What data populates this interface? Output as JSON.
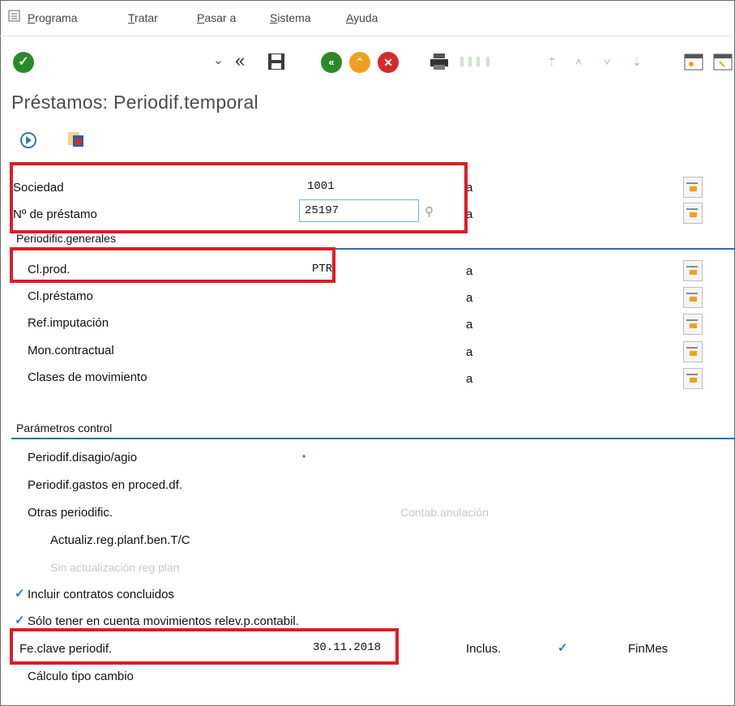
{
  "menu": [
    "Programa",
    "Tratar",
    "Pasar a",
    "Sistema",
    "Ayuda"
  ],
  "title": "Préstamos: Periodif.temporal",
  "header_fields": {
    "sociedad_label": "Sociedad",
    "sociedad_value": "1001",
    "prestamo_label": "Nº de préstamo",
    "prestamo_value": "25197",
    "a": "a"
  },
  "section_general": {
    "heading": "Periodific.generales",
    "rows": [
      {
        "label": "Cl.prod.",
        "value": "PTR",
        "a": "a"
      },
      {
        "label": "Cl.préstamo",
        "value": "",
        "a": "a"
      },
      {
        "label": "Ref.imputación",
        "value": "",
        "a": "a"
      },
      {
        "label": "Mon.contractual",
        "value": "",
        "a": "a"
      },
      {
        "label": "Clases de movimiento",
        "value": "",
        "a": "a"
      }
    ]
  },
  "section_control": {
    "heading": "Parámetros control",
    "disago": "Periodif.disagio/agio",
    "gastos": "Periodif.gastos en proced.df.",
    "otras": "Otras periodific.",
    "contab": "Contab.anulación",
    "actualiz": "Actualiz.reg.planf.ben.T/C",
    "sin_actualiz": "Sin actualización reg.plan",
    "incluir": "Incluir contratos concluidos",
    "solo": "Sólo tener en cuenta movimientos relev.p.contabil.",
    "fecha_label": "Fe.clave periodif.",
    "fecha_value": "30.11.2018",
    "inclus": "Inclus.",
    "finmes": "FinMes",
    "calculo": "Cálculo tipo cambio",
    "check_glyph": "✓"
  },
  "colors": {
    "accent_blue": "#2b6fb7",
    "highlight_red": "#e01b24",
    "green": "#2a8a2a",
    "orange": "#f0a020"
  }
}
